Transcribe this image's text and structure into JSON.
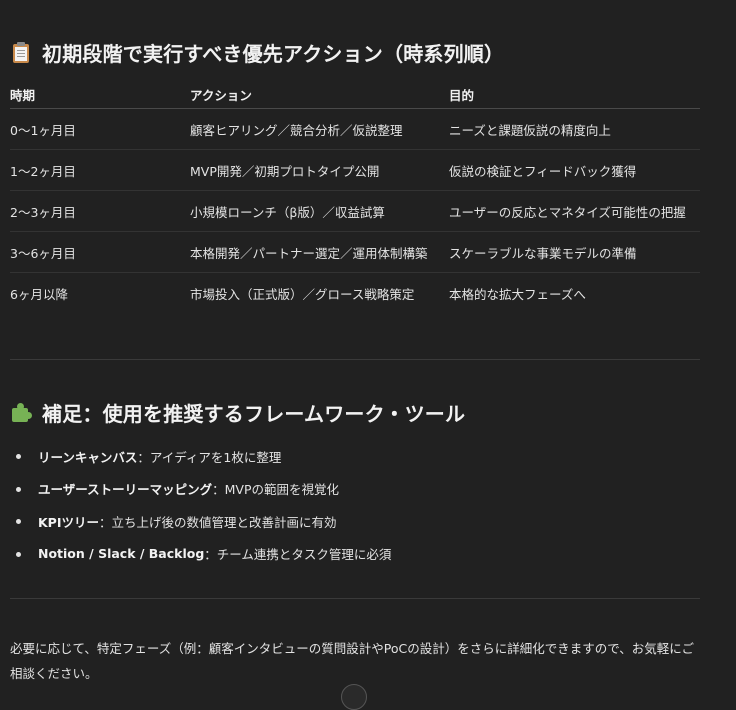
{
  "section1": {
    "title": "初期段階で実行すべき優先アクション（時系列順）",
    "icon": "clipboard-icon"
  },
  "table": {
    "headers": [
      "時期",
      "アクション",
      "目的"
    ],
    "rows": [
      [
        "0〜1ヶ月目",
        "顧客ヒアリング／競合分析／仮説整理",
        "ニーズと課題仮説の精度向上"
      ],
      [
        "1〜2ヶ月目",
        "MVP開発／初期プロトタイプ公開",
        "仮説の検証とフィードバック獲得"
      ],
      [
        "2〜3ヶ月目",
        "小規模ローンチ（β版）／収益試算",
        "ユーザーの反応とマネタイズ可能性の把握"
      ],
      [
        "3〜6ヶ月目",
        "本格開発／パートナー選定／運用体制構築",
        "スケーラブルな事業モデルの準備"
      ],
      [
        "6ヶ月以降",
        "市場投入（正式版）／グロース戦略策定",
        "本格的な拡大フェーズへ"
      ]
    ]
  },
  "section2": {
    "title": "補足：使用を推奨するフレームワーク・ツール",
    "icon": "puzzle-icon"
  },
  "tools": [
    {
      "term": "リーンキャンバス",
      "desc": "：アイディアを1枚に整理"
    },
    {
      "term": "ユーザーストーリーマッピング",
      "desc": "：MVPの範囲を視覚化"
    },
    {
      "term": "KPIツリー",
      "desc": "：立ち上げ後の数値管理と改善計画に有効"
    },
    {
      "term": "Notion / Slack / Backlog",
      "desc": "：チーム連携とタスク管理に必須"
    }
  ],
  "footer": {
    "text": "必要に応じて、特定フェーズ（例：顧客インタビューの質問設計やPoCの設計）をさらに詳細化できますので、お気軽にご相談ください。"
  },
  "colors": {
    "background": "#212121",
    "text": "#ececec"
  }
}
